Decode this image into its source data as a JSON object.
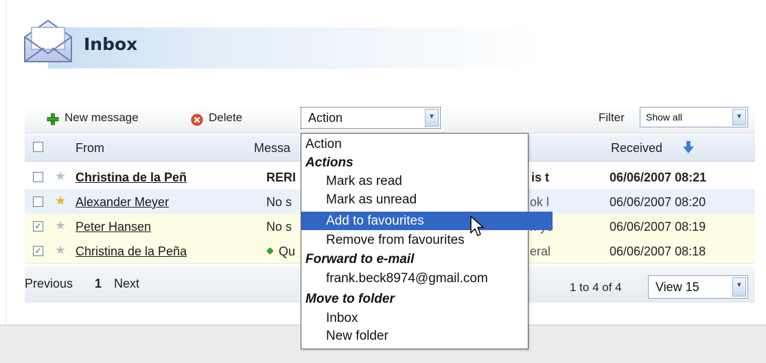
{
  "header": {
    "title": "Inbox",
    "icon": "envelope-icon"
  },
  "toolbar": {
    "new_message": "New message",
    "delete": "Delete",
    "action_select": "Action",
    "filter_label": "Filter",
    "filter_value": "Show all"
  },
  "table": {
    "columns": {
      "from": "From",
      "message": "Messa",
      "received": "Received"
    },
    "rows": [
      {
        "from": "Christina de la Peñ",
        "message": "RERI",
        "snippet": "is t",
        "received": "06/06/2007 08:21",
        "checked": false,
        "favourite": false,
        "unread": true
      },
      {
        "from": "Alexander Meyer",
        "message": "No s",
        "snippet": "ok l",
        "received": "06/06/2007 08:20",
        "checked": false,
        "favourite": true,
        "unread": false
      },
      {
        "from": "Peter Hansen",
        "message": "No s",
        "snippet": "n yo",
        "received": "06/06/2007 08:19",
        "checked": true,
        "favourite": false,
        "unread": false
      },
      {
        "from": "Christina de la Peña",
        "message": "Qu",
        "snippet": "eral",
        "received": "06/06/2007 08:18",
        "checked": true,
        "favourite": false,
        "unread": false
      }
    ]
  },
  "pager": {
    "previous": "Previous",
    "page": "1",
    "next": "Next",
    "range": "1 to 4 of 4",
    "view": "View 15"
  },
  "dropdown": {
    "items": [
      {
        "type": "option",
        "label": "Action"
      },
      {
        "type": "group",
        "label": "Actions"
      },
      {
        "type": "option",
        "label": "Mark as read"
      },
      {
        "type": "option",
        "label": "Mark as unread"
      },
      {
        "type": "option",
        "label": "Add to favourites",
        "selected": true
      },
      {
        "type": "option",
        "label": "Remove from favourites"
      },
      {
        "type": "group",
        "label": "Forward to e-mail"
      },
      {
        "type": "option",
        "label": "frank.beck8974@gmail.com"
      },
      {
        "type": "group",
        "label": "Move to folder"
      },
      {
        "type": "option",
        "label": "Inbox"
      },
      {
        "type": "option",
        "label": "New folder"
      }
    ]
  },
  "colors": {
    "accent": "#3166c4",
    "header_gradient": "#c9def1",
    "favourite_star": "#f2b51a",
    "unread_star": "#b9bfc9"
  }
}
